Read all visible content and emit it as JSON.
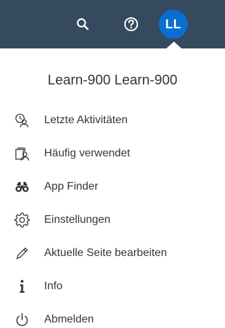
{
  "shellbar": {
    "avatar_initials": "LL",
    "background_color": "#354a5f",
    "avatar_color": "#0a6ed1",
    "icons": [
      "search-icon",
      "help-icon"
    ]
  },
  "user_menu": {
    "username": "Learn-900 Learn-900",
    "items": [
      {
        "label": "Letzte Aktivitäten",
        "icon": "recent-activity-icon"
      },
      {
        "label": "Häufig verwendet",
        "icon": "frequently-used-icon"
      },
      {
        "label": "App Finder",
        "icon": "app-finder-binoculars-icon"
      },
      {
        "label": "Einstellungen",
        "icon": "settings-gear-icon"
      },
      {
        "label": "Aktuelle Seite bearbeiten",
        "icon": "edit-pencil-icon"
      },
      {
        "label": "Info",
        "icon": "info-icon"
      },
      {
        "label": "Abmelden",
        "icon": "logout-power-icon"
      }
    ]
  }
}
